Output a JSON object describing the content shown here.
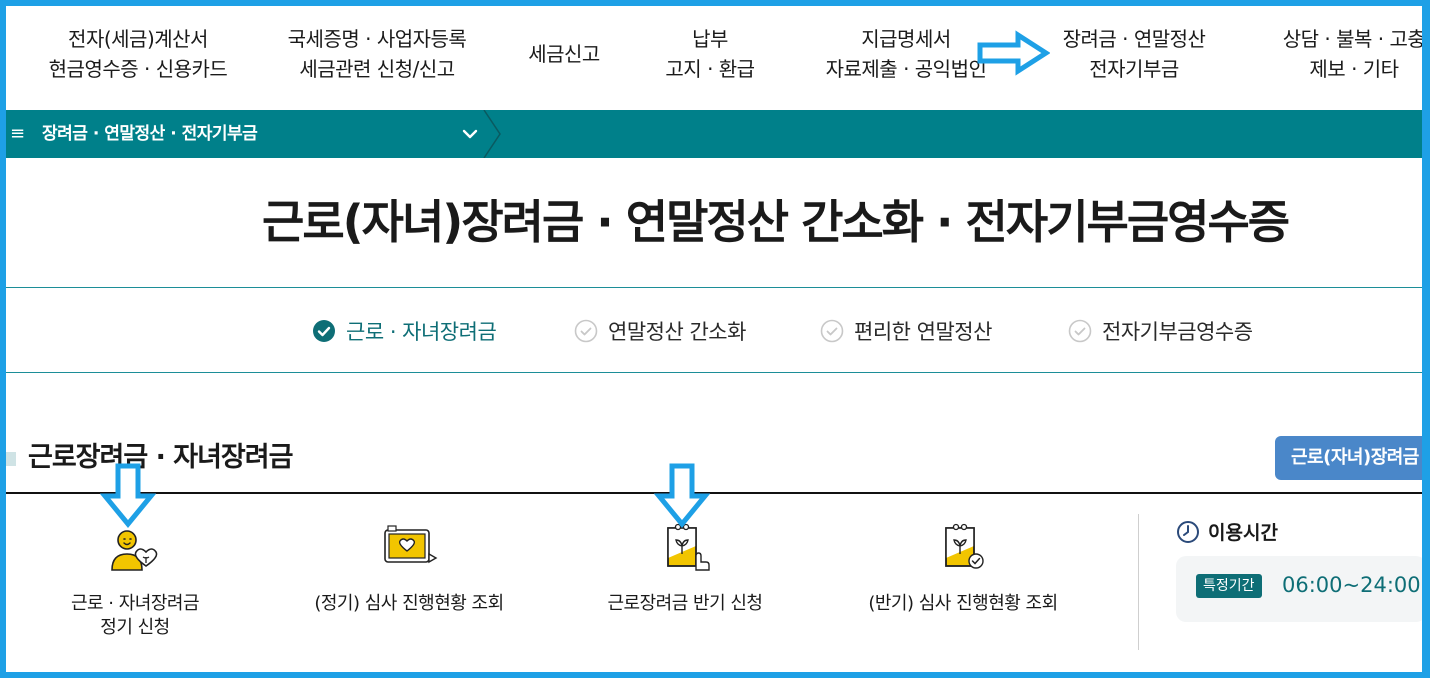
{
  "topnav": {
    "items": [
      {
        "line1": "전자(세금)계산서",
        "line2": "현금영수증 · 신용카드"
      },
      {
        "line1": "국세증명 · 사업자등록",
        "line2": "세금관련 신청/신고"
      },
      {
        "line1": "세금신고",
        "line2": ""
      },
      {
        "line1": "납부",
        "line2": "고지 · 환급"
      },
      {
        "line1": "지급명세서",
        "line2": "자료제출 · 공익법인"
      },
      {
        "line1": "장려금 · 연말정산",
        "line2": "전자기부금"
      },
      {
        "line1": "상담 · 불복 · 고충",
        "line2": "제보 · 기타"
      }
    ]
  },
  "breadcrumb": {
    "menu_icon": "≡",
    "label": "장려금 · 연말정산 · 전자기부금"
  },
  "page_title": "근로(자녀)장려금 · 연말정산 간소화 · 전자기부금영수증",
  "subtabs": [
    {
      "label": "근로 · 자녀장려금",
      "active": true
    },
    {
      "label": "연말정산 간소화",
      "active": false
    },
    {
      "label": "편리한 연말정산",
      "active": false
    },
    {
      "label": "전자기부금영수증",
      "active": false
    }
  ],
  "section": {
    "title": "근로장려금 · 자녀장려금",
    "button_label": "근로(자녀)장려금"
  },
  "services": [
    {
      "label_line1": "근로 · 자녀장려금",
      "label_line2": "정기 신청",
      "icon": "person-heart-icon"
    },
    {
      "label_line1": "(정기) 심사 진행현황 조회",
      "label_line2": "",
      "icon": "monitor-heart-icon"
    },
    {
      "label_line1": "근로장려금 반기 신청",
      "label_line2": "",
      "icon": "document-sprout-hand-icon"
    },
    {
      "label_line1": "(반기) 심사 진행현황 조회",
      "label_line2": "",
      "icon": "document-sprout-check-icon"
    }
  ],
  "usage": {
    "title": "이용시간",
    "badge": "특정기간",
    "time": "06:00~24:00"
  },
  "colors": {
    "frame": "#1ea0e6",
    "teal": "#00808a",
    "teal_dark": "#0e6e76",
    "button_blue": "#4a87c9",
    "icon_yellow": "#f2c500"
  }
}
